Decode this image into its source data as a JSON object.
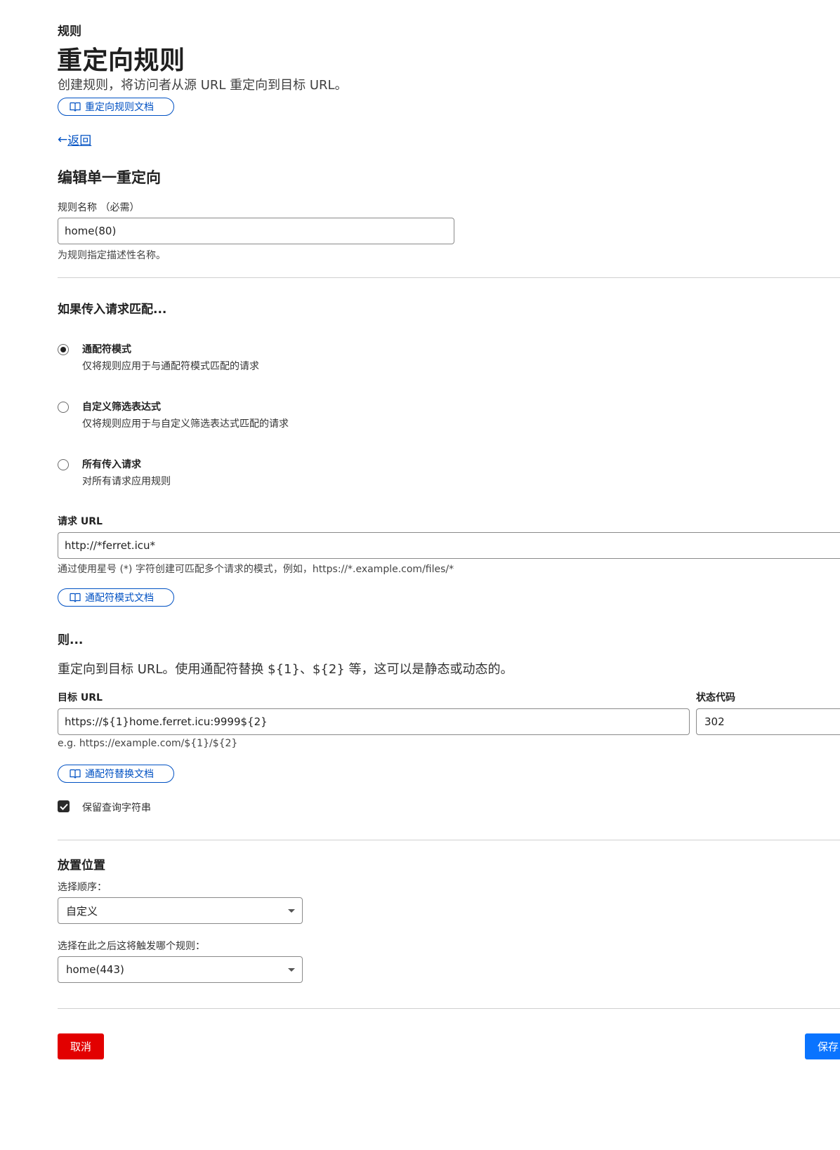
{
  "header": {
    "eyebrow": "规则",
    "title": "重定向规则",
    "subtitle": "创建规则，将访问者从源 URL 重定向到目标 URL。",
    "docs_label": "重定向规则文档"
  },
  "back_label": "返回",
  "form": {
    "section_title": "编辑单一重定向",
    "rule_name": {
      "label": "规则名称 （必需）",
      "value": "home(80)",
      "help": "为规则指定描述性名称。"
    }
  },
  "match": {
    "title": "如果传入请求匹配...",
    "options": [
      {
        "title": "通配符模式",
        "desc": "仅将规则应用于与通配符模式匹配的请求",
        "selected": true
      },
      {
        "title": "自定义筛选表达式",
        "desc": "仅将规则应用于与自定义筛选表达式匹配的请求",
        "selected": false
      },
      {
        "title": "所有传入请求",
        "desc": "对所有请求应用规则",
        "selected": false
      }
    ],
    "request_url": {
      "label": "请求 URL",
      "value": "http://*ferret.icu*",
      "help": "通过使用星号 (*) 字符创建可匹配多个请求的模式，例如，https://*.example.com/files/*",
      "docs_label": "通配符模式文档"
    }
  },
  "then": {
    "title": "则...",
    "desc": "重定向到目标 URL。使用通配符替换 ${1}、${2} 等，这可以是静态或动态的。",
    "target_url": {
      "label": "目标 URL",
      "value": "https://${1}home.ferret.icu:9999${2}",
      "help": "e.g. https://example.com/${1}/${2}"
    },
    "status_code": {
      "label": "状态代码",
      "value": "302"
    },
    "docs_label": "通配符替换文档",
    "preserve_query": {
      "label": "保留查询字符串",
      "checked": true
    }
  },
  "placement": {
    "title": "放置位置",
    "order_label": "选择顺序：",
    "order_value": "自定义",
    "after_label": "选择在此之后这将触发哪个规则：",
    "after_value": "home(443)"
  },
  "actions": {
    "cancel": "取消",
    "save": "保存"
  },
  "colors": {
    "link": "#0051c3",
    "cancel": "#e20000",
    "save": "#0a74ff"
  }
}
